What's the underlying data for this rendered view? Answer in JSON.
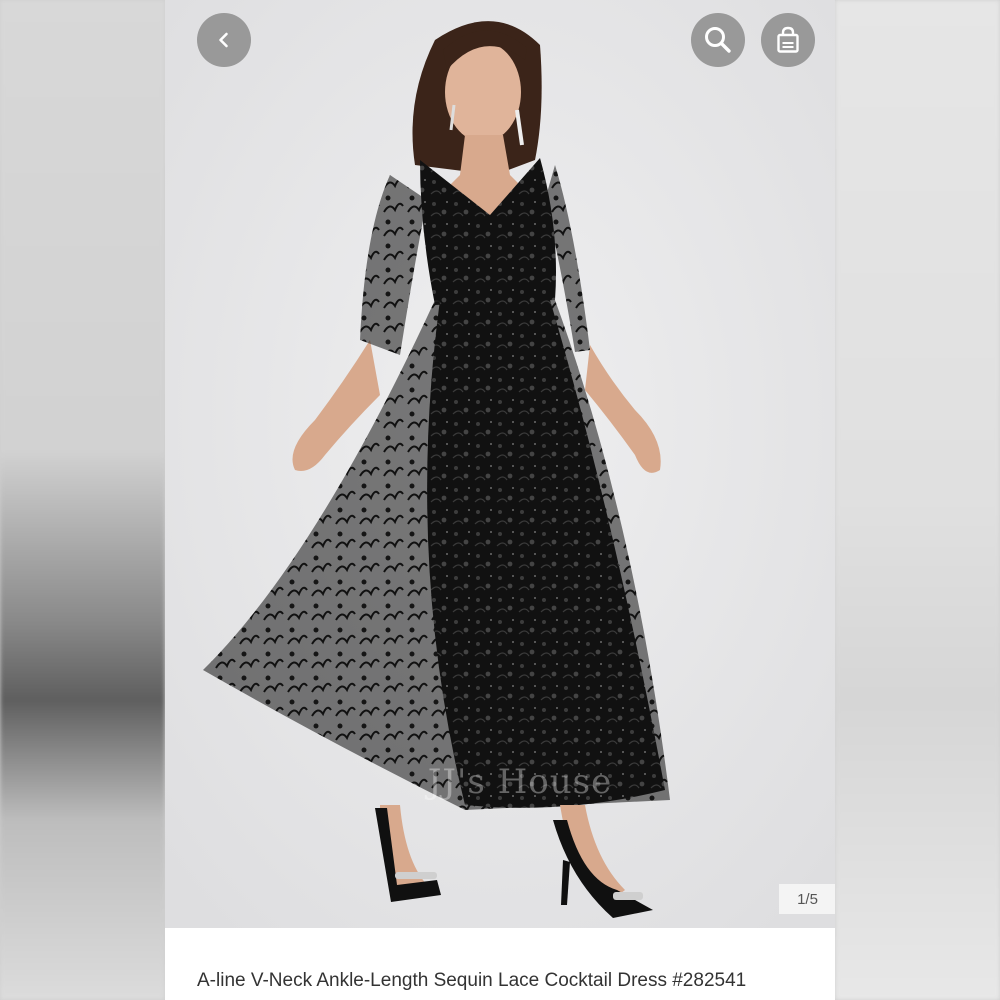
{
  "product": {
    "title": "A-line V-Neck Ankle-Length Sequin Lace Cocktail Dress  #282541",
    "image_counter": "1/5",
    "watermark": "JJ's House"
  },
  "nav": {
    "back_icon": "chevron-left-icon",
    "search_icon": "search-icon",
    "bag_icon": "shopping-bag-icon"
  },
  "colors": {
    "dress": "#141414",
    "background": "#e7e7e8",
    "button": "#8c8c8c"
  }
}
